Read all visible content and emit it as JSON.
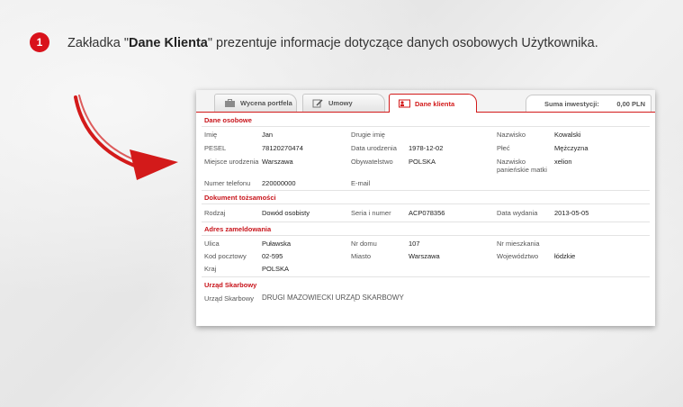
{
  "step": "1",
  "intro": {
    "prefix": "Zakładka \"",
    "bold": "Dane Klienta",
    "suffix": "\" prezentuje informacje dotyczące danych osobowych Użytkownika."
  },
  "tabs": [
    {
      "label": "Wycena portfela",
      "icon": "briefcase-icon"
    },
    {
      "label": "Umowy",
      "icon": "pencil-icon"
    },
    {
      "label": "Dane klienta",
      "icon": "person-card-icon"
    }
  ],
  "investment_sum": {
    "label": "Suma inwestycji:",
    "value": "0,00 PLN"
  },
  "sections": {
    "personal": {
      "title": "Dane osobowe",
      "first_name": {
        "label": "Imię",
        "value": "Jan"
      },
      "second_name": {
        "label": "Drugie imię",
        "value": ""
      },
      "last_name": {
        "label": "Nazwisko",
        "value": "Kowalski"
      },
      "pesel": {
        "label": "PESEL",
        "value": "78120270474"
      },
      "birth_date": {
        "label": "Data urodzenia",
        "value": "1978-12-02"
      },
      "sex": {
        "label": "Płeć",
        "value": "Mężczyzna"
      },
      "birth_place": {
        "label": "Miejsce urodzenia",
        "value": "Warszawa"
      },
      "citizenship": {
        "label": "Obywatelstwo",
        "value": "POLSKA"
      },
      "maiden_name": {
        "label_1": "Nazwisko",
        "label_2": "panieńskie matki",
        "value": "xelion"
      },
      "phone": {
        "label": "Numer telefonu",
        "value": "220000000"
      },
      "email": {
        "label": "E-mail",
        "value": ""
      }
    },
    "identity": {
      "title": "Dokument tożsamości",
      "type": {
        "label": "Rodzaj",
        "value": "Dowód osobisty"
      },
      "number": {
        "label": "Seria i numer",
        "value": "ACP078356"
      },
      "issue_date": {
        "label": "Data wydania",
        "value": "2013-05-05"
      }
    },
    "address": {
      "title": "Adres zameldowania",
      "street": {
        "label": "Ulica",
        "value": "Puławska"
      },
      "house_no": {
        "label": "Nr domu",
        "value": "107"
      },
      "flat_no": {
        "label": "Nr mieszkania",
        "value": ""
      },
      "postal_code": {
        "label": "Kod pocztowy",
        "value": "02-595"
      },
      "city": {
        "label": "Miasto",
        "value": "Warszawa"
      },
      "province": {
        "label": "Województwo",
        "value": "łódzkie"
      },
      "country": {
        "label": "Kraj",
        "value": "POLSKA"
      }
    },
    "tax_office": {
      "title": "Urząd Skarbowy",
      "office": {
        "label": "Urząd Skarbowy",
        "value": "DRUGI MAZOWIECKI URZĄD SKARBOWY"
      }
    }
  },
  "colors": {
    "accent": "#d31a1a",
    "badge": "#d9121b"
  }
}
